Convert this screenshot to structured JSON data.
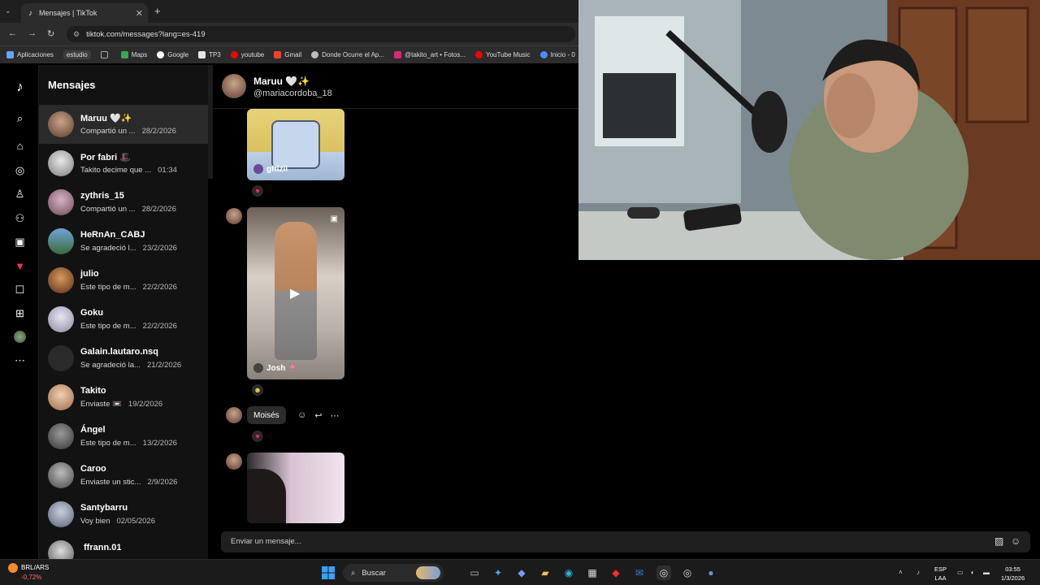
{
  "browser": {
    "tab_title": "Mensajes | TikTok",
    "url": "tiktok.com/messages?lang=es-419",
    "bookmarks": [
      "Aplicaciones",
      "estudio",
      "Maps",
      "Google",
      "TP3",
      "youtube",
      "Gmail",
      "Donde Ocurre el Ap...",
      "@takito_art • Fotos...",
      "YouTube Music",
      "Inicio - 0"
    ]
  },
  "sidebar": {
    "title": "Mensajes"
  },
  "conversations": [
    {
      "name": "Maruu 🤍✨",
      "preview": "Compartió un ...",
      "date": "28/2/2026"
    },
    {
      "name": "Por fabri 🎩",
      "preview": "Takito decime que ...",
      "date": "01:34"
    },
    {
      "name": "zythris_15",
      "preview": "Compartió un ...",
      "date": "28/2/2026"
    },
    {
      "name": "HeRnAn_CABJ",
      "preview": "Se agradeció l...",
      "date": "23/2/2026"
    },
    {
      "name": "julio",
      "preview": "Este tipo de m...",
      "date": "22/2/2026"
    },
    {
      "name": "Goku",
      "preview": "Este tipo de m...",
      "date": "22/2/2026"
    },
    {
      "name": "Galain.lautaro.nsq",
      "preview": "Se agradeció la...",
      "date": "21/2/2026"
    },
    {
      "name": "Takito",
      "preview": "Enviaste 📼",
      "date": "19/2/2026"
    },
    {
      "name": "Ángel",
      "preview": "Este tipo de m...",
      "date": "13/2/2026"
    },
    {
      "name": "Caroo",
      "preview": "Enviaste un stic...",
      "date": "2/9/2026"
    },
    {
      "name": "Santybarru",
      "preview": "Voy bien",
      "date": "02/05/2026"
    },
    {
      "name": "ffrann.01",
      "preview": "",
      "date": ""
    }
  ],
  "chat": {
    "name": "Maruu 🤍✨",
    "handle": "@mariacordoba_18",
    "video1_label": "gftizii",
    "video2_label": "Josh 🦩",
    "reaction_label": "Moisés",
    "compose_placeholder": "Enviar un mensaje..."
  },
  "taskbar": {
    "ticker": "BRL/ARS",
    "change": "-0,72%",
    "search": "Buscar",
    "lang1": "ESP",
    "lang2": "LAA",
    "time": "03:55",
    "date": "1/3/2026"
  }
}
